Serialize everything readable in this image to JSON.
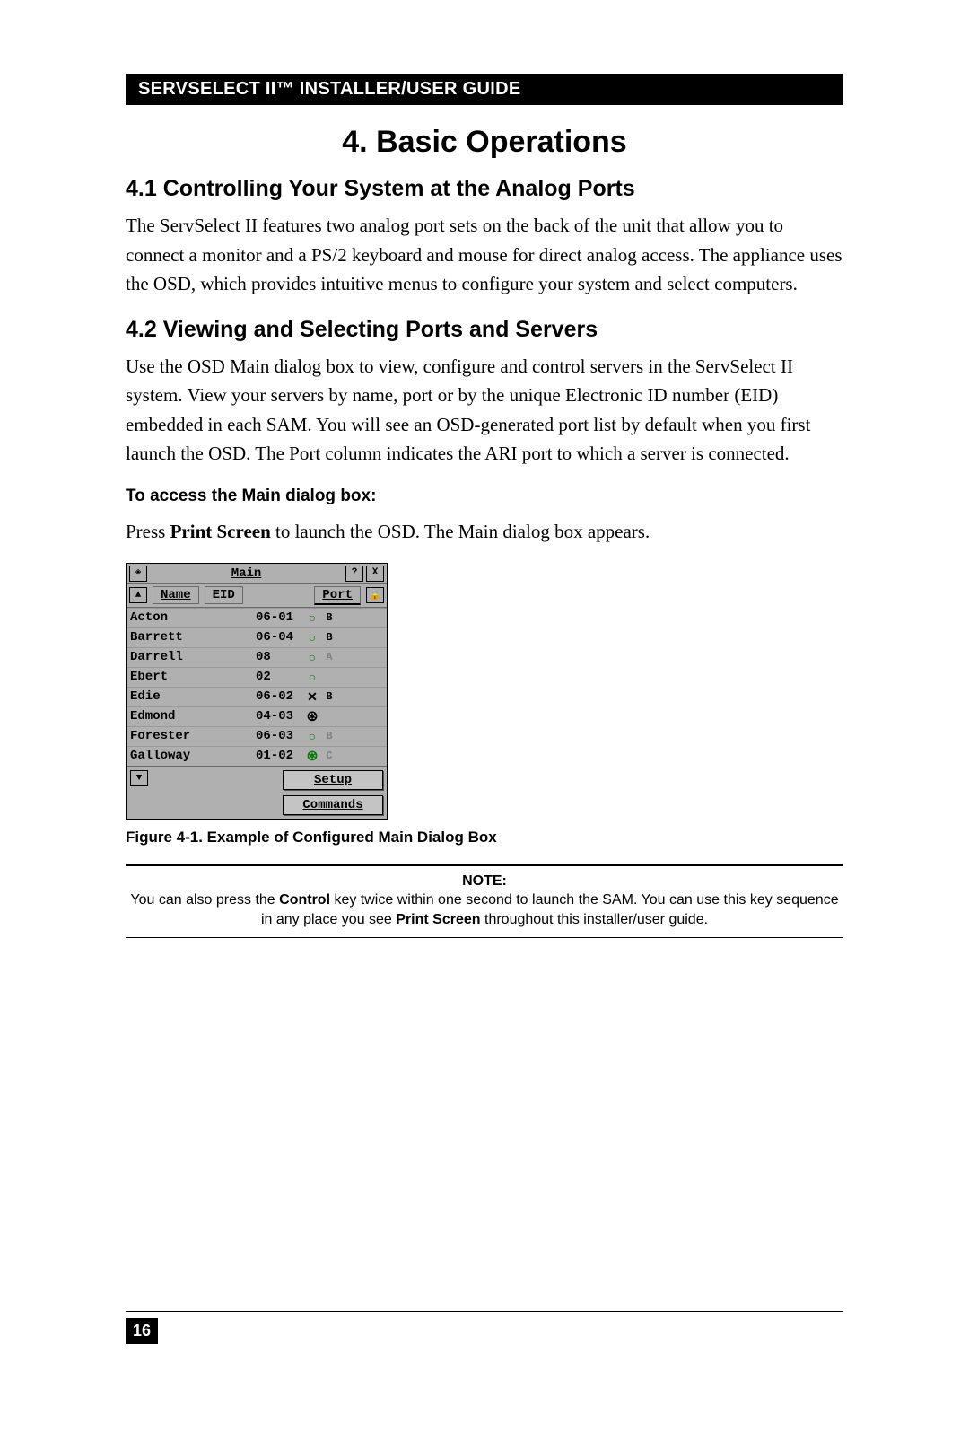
{
  "header": {
    "title": "SERVSELECT II™ INSTALLER/USER GUIDE"
  },
  "chapter": {
    "title": "4. Basic Operations"
  },
  "sections": [
    {
      "title": "4.1 Controlling Your System at the Analog Ports",
      "body": "The ServSelect II features two analog port sets on the back of the unit that allow you to connect a monitor and a PS/2 keyboard and mouse for direct analog access. The appliance uses the OSD, which provides intuitive menus to configure your system and select computers."
    },
    {
      "title": "4.2 Viewing and Selecting Ports and Servers",
      "body": "Use the OSD Main dialog box to view, configure and control servers in the ServSelect II system. View your servers by name, port or by the unique Electronic ID number (EID) embedded in each SAM. You will see an OSD-generated port list by default when you first launch the OSD. The Port column indicates the ARI port to which a server is connected."
    }
  ],
  "subheading": "To access the Main dialog box:",
  "instruction": {
    "pre": "Press ",
    "key": "Print Screen",
    "post": " to launch the OSD. The Main dialog box appears."
  },
  "osd": {
    "title": "Main",
    "help": "?",
    "close": "X",
    "columns": {
      "name": "Name",
      "eid": "EID",
      "port": "Port"
    },
    "rows": [
      {
        "name": "Acton",
        "port": "06-01",
        "status": "circle-green",
        "ch": "B"
      },
      {
        "name": "Barrett",
        "port": "06-04",
        "status": "circle-green",
        "ch": "B"
      },
      {
        "name": "Darrell",
        "port": "08",
        "status": "circle-green",
        "ch": "A",
        "dim": true
      },
      {
        "name": "Ebert",
        "port": "02",
        "status": "circle-green",
        "ch": ""
      },
      {
        "name": "Edie",
        "port": "06-02",
        "status": "x-black",
        "ch": "B"
      },
      {
        "name": "Edmond",
        "port": "04-03",
        "status": "net-black",
        "ch": ""
      },
      {
        "name": "Forester",
        "port": "06-03",
        "status": "circle-green",
        "ch": "B",
        "dim": true
      },
      {
        "name": "Galloway",
        "port": "01-02",
        "status": "net-green",
        "ch": "C",
        "dim": true
      }
    ],
    "buttons": {
      "setup": "Setup",
      "commands": "Commands"
    }
  },
  "figure_caption": "Figure 4-1. Example of Configured Main Dialog Box",
  "note": {
    "title": "NOTE:",
    "pre": "You can also press the ",
    "key1": "Control",
    "mid": " key twice within one second to launch the SAM. You can use this key sequence in any place you see ",
    "key2": "Print Screen",
    "post": " throughout this installer/user guide."
  },
  "page_number": "16"
}
